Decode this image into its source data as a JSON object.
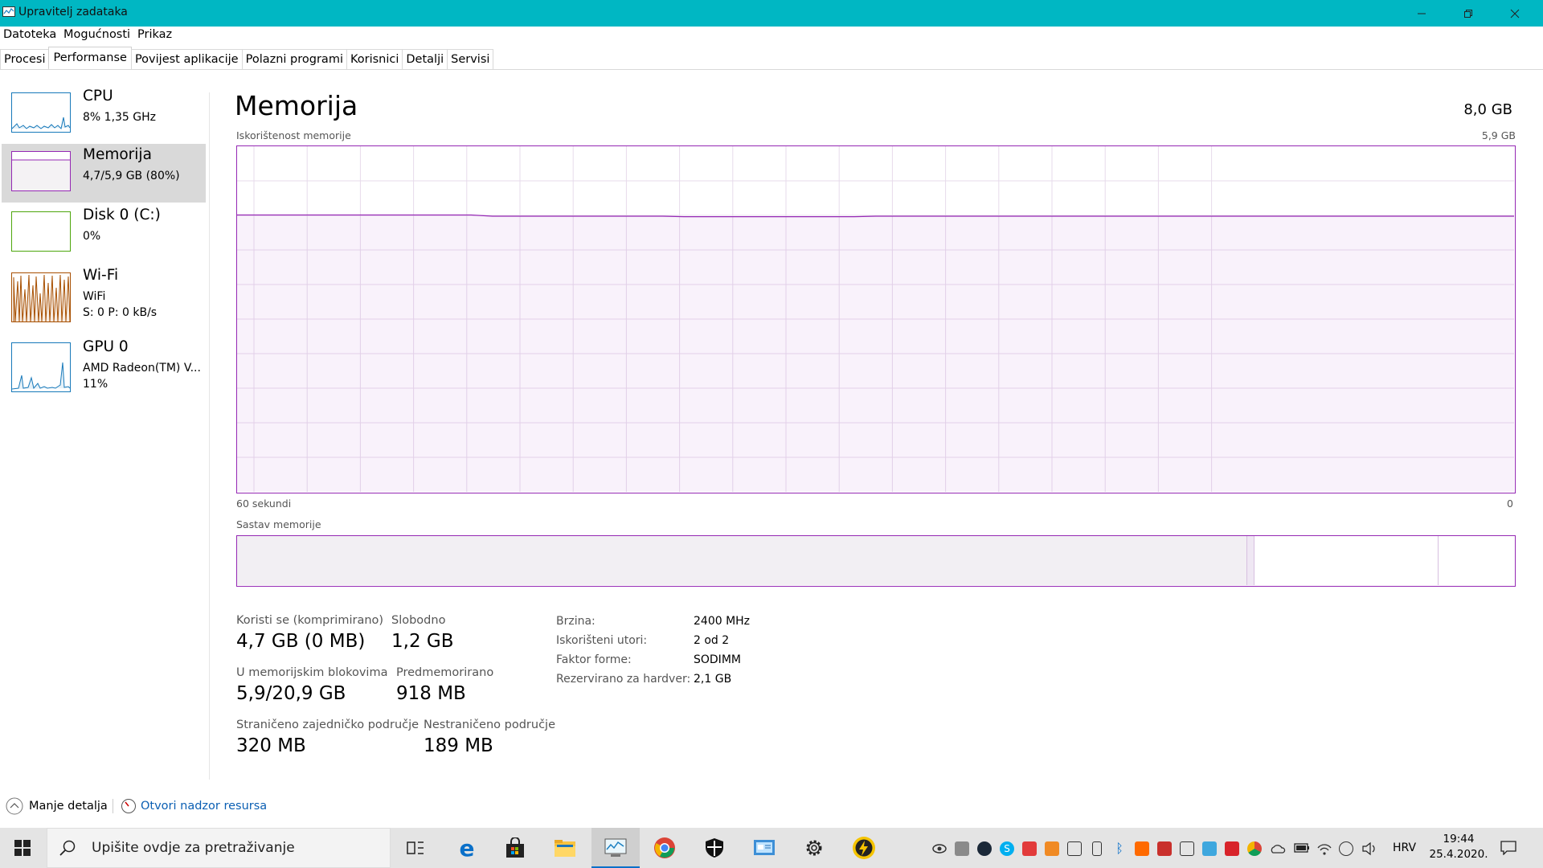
{
  "window": {
    "title": "Upravitelj zadataka",
    "accent": "#00b7c3"
  },
  "menu": [
    "Datoteka",
    "Mogućnosti",
    "Prikaz"
  ],
  "tabs": [
    "Procesi",
    "Performanse",
    "Povijest aplikacije",
    "Polazni programi",
    "Korisnici",
    "Detalji",
    "Servisi"
  ],
  "active_tab": "Performanse",
  "sidebar": {
    "items": [
      {
        "name": "CPU",
        "line1": "8%  1,35 GHz",
        "line2": "",
        "color": "#1779ba"
      },
      {
        "name": "Memorija",
        "line1": "4,7/5,9 GB (80%)",
        "line2": "",
        "color": "#9528b4"
      },
      {
        "name": "Disk 0 (C:)",
        "line1": "0%",
        "line2": "",
        "color": "#4da60c"
      },
      {
        "name": "Wi-Fi",
        "line1": "WiFi",
        "line2": "S: 0  P: 0 kB/s",
        "color": "#a74f01"
      },
      {
        "name": "GPU 0",
        "line1": "AMD Radeon(TM) V...",
        "line2": "11%",
        "color": "#1779ba"
      }
    ]
  },
  "main": {
    "heading": "Memorija",
    "total": "8,0 GB",
    "graph_label": "Iskorištenost memorije",
    "graph_max": "5,9 GB",
    "time_left": "60 sekundi",
    "time_right": "0",
    "composition_label": "Sastav memorije",
    "usage_fraction": 0.8
  },
  "stats": {
    "in_use_label": "Koristi se (komprimirano)",
    "in_use_value": "4,7 GB (0 MB)",
    "available_label": "Slobodno",
    "available_value": "1,2 GB",
    "committed_label": "U memorijskim blokovima",
    "committed_value": "5,9/20,9 GB",
    "cached_label": "Predmemorirano",
    "cached_value": "918 MB",
    "paged_label": "Straničeno zajedničko područje",
    "paged_value": "320 MB",
    "nonpaged_label": "Nestraničeno područje",
    "nonpaged_value": "189 MB"
  },
  "details": [
    {
      "key": "Brzina:",
      "value": "2400 MHz"
    },
    {
      "key": "Iskorišteni utori:",
      "value": "2 od 2"
    },
    {
      "key": "Faktor forme:",
      "value": "SODIMM"
    },
    {
      "key": "Rezervirano za hardver:",
      "value": "2,1 GB"
    }
  ],
  "footer": {
    "fewer_details": "Manje detalja",
    "resource_monitor": "Otvori nadzor resursa"
  },
  "taskbar": {
    "search_placeholder": "Upišite ovdje za pretraživanje",
    "language": "HRV",
    "time": "19:44",
    "date": "25.4.2020."
  }
}
